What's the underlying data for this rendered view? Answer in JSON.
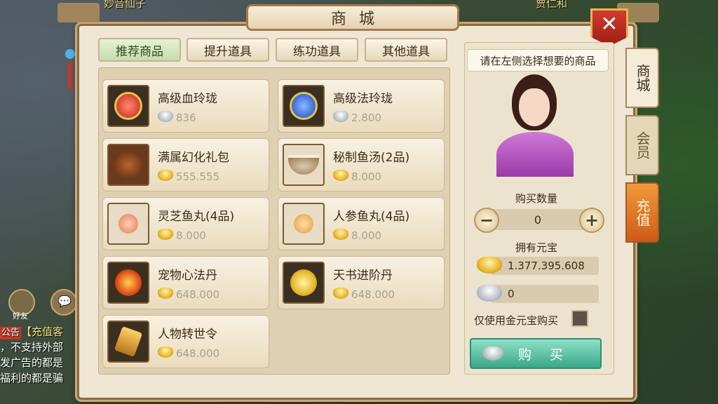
{
  "background": {
    "name_left": "妙音仙子",
    "name_right": "贾仁和",
    "friends_label": "好友",
    "chat": {
      "tag": "公告",
      "line1": "【充值客",
      "line2": "，不支持外部",
      "line3": "发广告的都是",
      "line4": "福利的都是骗"
    }
  },
  "window": {
    "title": "商城",
    "close_symbol": "✕"
  },
  "tabs": [
    {
      "label": "推荐商品",
      "active": true
    },
    {
      "label": "提升道具",
      "active": false
    },
    {
      "label": "练功道具",
      "active": false
    },
    {
      "label": "其他道具",
      "active": false
    }
  ],
  "items": [
    {
      "name": "高级血玲珑",
      "price": "836",
      "currency": "silver",
      "icon": "red-orb-icon"
    },
    {
      "name": "高级法玲珑",
      "price": "2.800",
      "currency": "silver",
      "icon": "blue-orb-icon"
    },
    {
      "name": "满属幻化礼包",
      "price": "555.555",
      "currency": "gold",
      "icon": "bear-icon"
    },
    {
      "name": "秘制鱼汤(2品)",
      "price": "8.000",
      "currency": "gold",
      "icon": "soup-bowl-icon"
    },
    {
      "name": "灵芝鱼丸(4品)",
      "price": "8.000",
      "currency": "gold",
      "icon": "fishball-plate-icon"
    },
    {
      "name": "人参鱼丸(4品)",
      "price": "8.000",
      "currency": "gold",
      "icon": "fishball-bowl-icon"
    },
    {
      "name": "宠物心法丹",
      "price": "648.000",
      "currency": "gold",
      "icon": "fire-orb-icon"
    },
    {
      "name": "天书进阶丹",
      "price": "648.000",
      "currency": "gold",
      "icon": "golden-orb-icon"
    },
    {
      "name": "人物转世令",
      "price": "648.000",
      "currency": "gold",
      "icon": "token-icon"
    }
  ],
  "right_panel": {
    "hint": "请在左侧选择想要的商品",
    "qty_label": "购买数量",
    "qty_value": "0",
    "minus": "−",
    "plus": "+",
    "owned_label": "拥有元宝",
    "gold_amount": "1.377.395.608",
    "silver_amount": "0",
    "gold_only_label": "仅使用金元宝购买",
    "buy_label": "购买"
  },
  "side_tabs": [
    {
      "label": "商城",
      "active": true
    },
    {
      "label": "会员",
      "active": false
    },
    {
      "label": "充值",
      "active": false
    }
  ],
  "colors": {
    "panel": "#efe6d3",
    "frame": "#8a6a45",
    "close": "#c0392b",
    "buy_button": "#4fc0a0",
    "recharge_tab": "#e2792a"
  }
}
